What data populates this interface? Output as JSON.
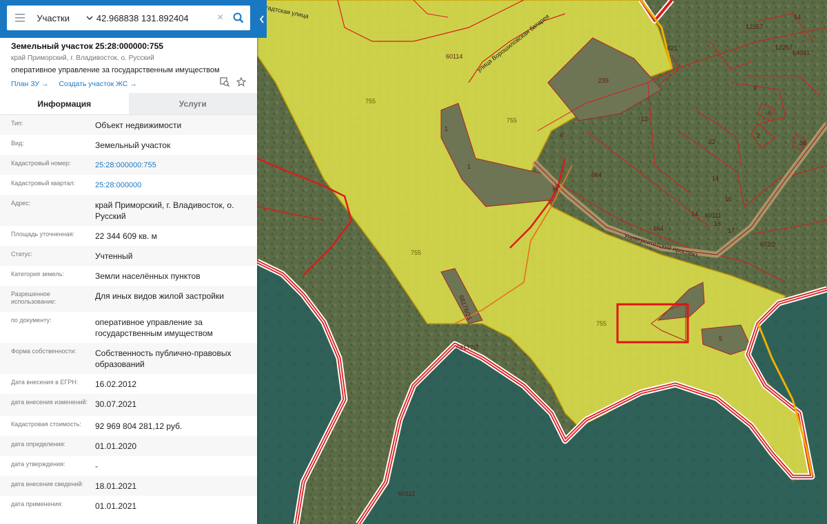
{
  "search": {
    "type_label": "Участки",
    "query": "42.968838 131.892404"
  },
  "parcel": {
    "title": "Земельный участок 25:28:000000:755",
    "location": "край Приморский, г. Владивосток, о. Русский",
    "rights": "оперативное управление за государственным имуществом",
    "link_plan": "План ЗУ →",
    "link_create": "Создать участок ЖС →"
  },
  "tabs": {
    "info": "Информация",
    "services": "Услуги"
  },
  "info": [
    {
      "k": "Тип:",
      "v": "Объект недвижимости"
    },
    {
      "k": "Вид:",
      "v": "Земельный участок"
    },
    {
      "k": "Кадастровый номер:",
      "v": "25:28:000000:755"
    },
    {
      "k": "Кадастровый квартал:",
      "v": "25:28:000000"
    },
    {
      "k": "Адрес:",
      "v": "край Приморский, г. Владивосток, о. Русский"
    },
    {
      "k": "Площадь уточненная:",
      "v": "22 344 609 кв. м"
    },
    {
      "k": "Статус:",
      "v": "Учтенный"
    },
    {
      "k": "Категория земель:",
      "v": "Земли населённых пунктов"
    },
    {
      "k": "Разрешенное использование:",
      "v": "Для иных видов жилой застройки"
    },
    {
      "k": "по документу:",
      "v": "оперативное управление за государственным имуществом"
    },
    {
      "k": "Форма собственности:",
      "v": "Собственность публично-правовых образований"
    },
    {
      "k": "Дата внесения в ЕГРН:",
      "v": "16.02.2012"
    },
    {
      "k": "дата внесения изменений:",
      "v": "30.07.2021"
    },
    {
      "k": "Кадастровая стоимость:",
      "v": "92 969 804 281,12 руб."
    },
    {
      "k": "дата определения:",
      "v": "01.01.2020"
    },
    {
      "k": "дата утверждения:",
      "v": "-"
    },
    {
      "k": "дата внесения сведений:",
      "v": "18.01.2021"
    },
    {
      "k": "дата применения:",
      "v": "01.01.2021"
    }
  ],
  "map": {
    "parcel_labels": [
      "755",
      "755",
      "755",
      "755",
      "1",
      "1",
      "239",
      "4",
      "12",
      "664",
      "664",
      "32",
      "14",
      "14",
      "16",
      "16",
      "17",
      "9",
      "6",
      "2",
      "36",
      "12257",
      "12257",
      "54",
      "64041",
      "60111",
      "672/2",
      "5",
      "60114",
      "68178/25",
      "68177/7",
      "60112",
      "85",
      "621"
    ],
    "street_labels": [
      "Университетский проспект",
      "улица Ворошиловская батарея",
      "Стадтская улица"
    ]
  },
  "colors": {
    "accent": "#1a78c2",
    "parcel_fill": "#e6e84a",
    "boundary": "#d81c1c",
    "selection": "#e01515"
  }
}
